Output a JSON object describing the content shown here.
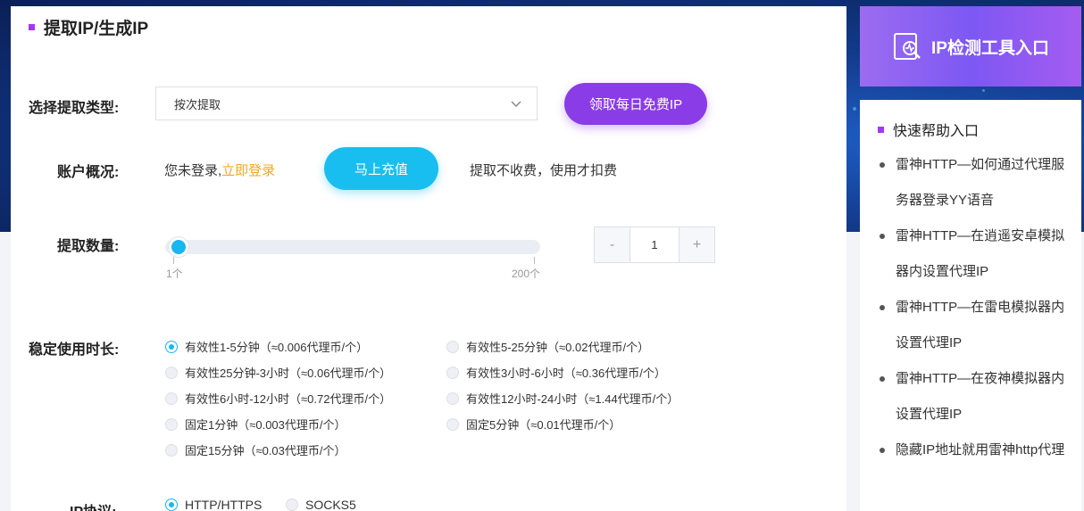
{
  "page": {
    "title": "提取IP/生成IP"
  },
  "form": {
    "type_label": "选择提取类型:",
    "type_value": "按次提取",
    "free_ip_button": "领取每日免费IP",
    "account_label": "账户概况:",
    "account_status": "您未登录,",
    "login_link": "立即登录",
    "recharge_button": "马上充值",
    "fee_note": "提取不收费，使用才扣费",
    "quantity_label": "提取数量:",
    "slider_min": "1个",
    "slider_max": "200个",
    "quantity_value": "1",
    "minus": "-",
    "plus": "+",
    "duration_label": "稳定使用时长:",
    "durations": [
      "有效性1-5分钟（≈0.006代理币/个）",
      "有效性5-25分钟（≈0.02代理币/个）",
      "有效性25分钟-3小时（≈0.06代理币/个）",
      "有效性3小时-6小时（≈0.36代理币/个）",
      "有效性6小时-12小时（≈0.72代理币/个）",
      "有效性12小时-24小时（≈1.44代理币/个）",
      "固定1分钟（≈0.003代理币/个）",
      "固定5分钟（≈0.01代理币/个）",
      "固定15分钟（≈0.03代理币/个）"
    ],
    "protocol_label": "IP协议:",
    "protocols": [
      "HTTP/HTTPS",
      "SOCKS5"
    ]
  },
  "sidebar": {
    "tool_banner": "IP检测工具入口",
    "help_title": "快速帮助入口",
    "help_items": [
      "雷神HTTP—如何通过代理服务器登录YY语音",
      "雷神HTTP—在逍遥安卓模拟器内设置代理IP",
      "雷神HTTP—在雷电模拟器内设置代理IP",
      "雷神HTTP—在夜神模拟器内设置代理IP",
      "隐藏IP地址就用雷神http代理"
    ]
  },
  "colors": {
    "accent_purple": "#8a3ce6",
    "accent_cyan": "#19bef0",
    "link_orange": "#f5a623"
  }
}
